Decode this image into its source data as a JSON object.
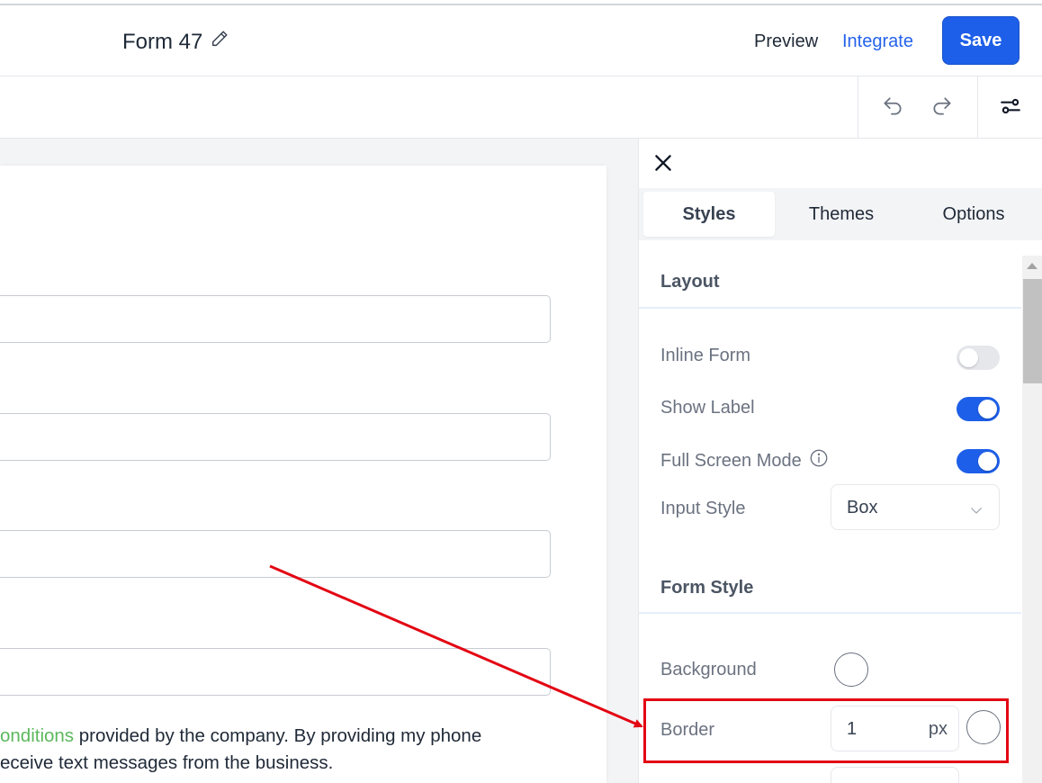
{
  "header": {
    "form_title": "Form 47",
    "preview_label": "Preview",
    "integrate_label": "Integrate",
    "save_label": "Save"
  },
  "toolbar": {
    "icons": [
      "undo-icon",
      "redo-icon",
      "settings-sliders-icon"
    ]
  },
  "canvas": {
    "consent_line1_link": "onditions",
    "consent_line1_rest": " provided by the company. By providing my phone",
    "consent_line2": "eceive text messages from the business."
  },
  "panel": {
    "tabs": [
      {
        "label": "Styles",
        "active": true
      },
      {
        "label": "Themes",
        "active": false
      },
      {
        "label": "Options",
        "active": false
      }
    ],
    "layout": {
      "title": "Layout",
      "inline_form_label": "Inline Form",
      "inline_form_on": false,
      "show_label_label": "Show Label",
      "show_label_on": true,
      "full_screen_label": "Full Screen Mode",
      "full_screen_on": true,
      "input_style_label": "Input Style",
      "input_style_value": "Box"
    },
    "form_style": {
      "title": "Form Style",
      "background_label": "Background",
      "border_label": "Border",
      "border_value": "1",
      "border_unit": "px"
    }
  },
  "colors": {
    "primary": "#1d5fe8",
    "link_green": "#5cb85c",
    "annotation_red": "#e30613"
  }
}
